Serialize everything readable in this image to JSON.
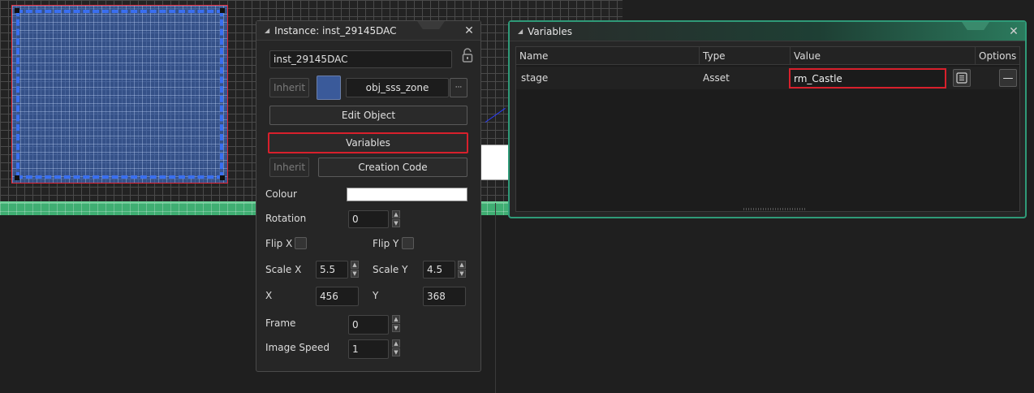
{
  "instance_panel": {
    "title": "Instance: inst_29145DAC",
    "name_value": "inst_29145DAC",
    "inherit_label": "Inherit",
    "object_name": "obj_sss_zone",
    "more_label": "···",
    "edit_object_label": "Edit Object",
    "variables_label": "Variables",
    "inherit2_label": "Inherit",
    "creation_code_label": "Creation Code",
    "colour_label": "Colour",
    "rotation_label": "Rotation",
    "rotation_value": "0",
    "flip_x_label": "Flip X",
    "flip_y_label": "Flip Y",
    "scale_x_label": "Scale X",
    "scale_x_value": "5.5",
    "scale_y_label": "Scale Y",
    "scale_y_value": "4.5",
    "x_label": "X",
    "x_value": "456",
    "y_label": "Y",
    "y_value": "368",
    "frame_label": "Frame",
    "frame_value": "0",
    "image_speed_label": "Image Speed",
    "image_speed_value": "1",
    "close_glyph": "✕"
  },
  "variables_panel": {
    "title": "Variables",
    "close_glyph": "✕",
    "columns": [
      "Name",
      "Type",
      "Value",
      "Options"
    ],
    "rows": [
      {
        "name": "stage",
        "type": "Asset",
        "value": "rm_Castle",
        "remove_glyph": "—"
      }
    ]
  },
  "colors": {
    "highlight_red": "#d8202c",
    "panel_accent_green": "#2f9a78",
    "object_color": "#3a5a9a",
    "colour_swatch": "#ffffff"
  }
}
